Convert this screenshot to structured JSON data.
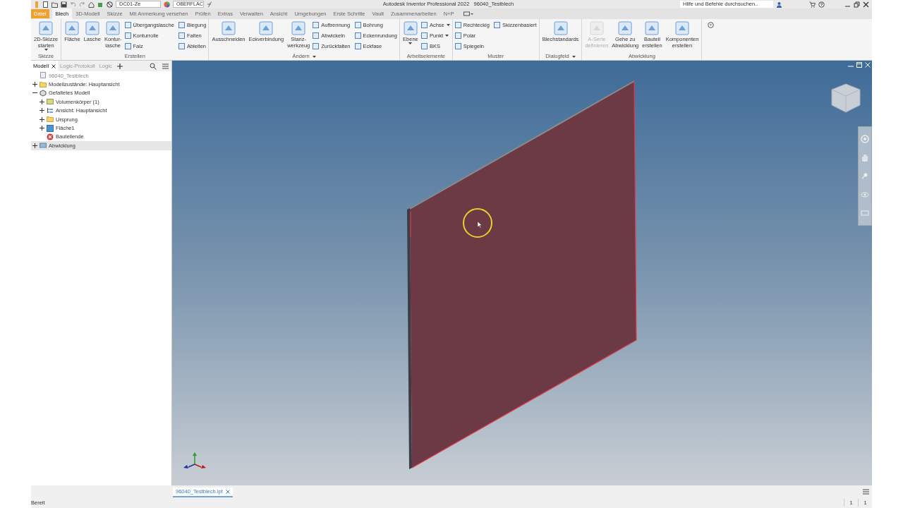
{
  "window": {
    "title": "Autodesk Inventor Professional 2022   96040_Testblech",
    "search": {
      "placeholder": "Hilfe und Befehle durchsuchen.."
    }
  },
  "quick_access": {
    "design_view": "DC01-Ze",
    "appearance": "OBERFLAC"
  },
  "menu_tabs": [
    {
      "label": "Datei",
      "kind": "file",
      "selected": false
    },
    {
      "label": "Blech",
      "kind": "tab",
      "selected": true
    },
    {
      "label": "3D-Modell",
      "kind": "tab",
      "selected": false
    },
    {
      "label": "Skizze",
      "kind": "tab",
      "selected": false
    },
    {
      "label": "Mit Anmerkung versehen",
      "kind": "tab",
      "selected": false
    },
    {
      "label": "Prüfen",
      "kind": "tab",
      "selected": false
    },
    {
      "label": "Extras",
      "kind": "tab",
      "selected": false
    },
    {
      "label": "Verwalten",
      "kind": "tab",
      "selected": false
    },
    {
      "label": "Ansicht",
      "kind": "tab",
      "selected": false
    },
    {
      "label": "Umgebungen",
      "kind": "tab",
      "selected": false
    },
    {
      "label": "Erste Schritte",
      "kind": "tab",
      "selected": false
    },
    {
      "label": "Vault",
      "kind": "tab",
      "selected": false
    },
    {
      "label": "Zusammenarbeiten",
      "kind": "tab",
      "selected": false
    },
    {
      "label": "N+P",
      "kind": "tab",
      "selected": false
    }
  ],
  "ribbon": [
    {
      "title": "Skizze",
      "menu": false,
      "tools": [
        {
          "lines": [
            "2D-Skizze",
            "starten"
          ],
          "kind": "large",
          "disabled": false,
          "menu": true
        }
      ]
    },
    {
      "title": "Erstellen",
      "menu": false,
      "tools": [
        {
          "lines": [
            "Fläche"
          ],
          "kind": "large",
          "disabled": false,
          "menu": false
        },
        {
          "lines": [
            "Lasche"
          ],
          "kind": "large",
          "disabled": false,
          "menu": false
        },
        {
          "lines": [
            "Kontur-",
            "lasche"
          ],
          "kind": "large",
          "disabled": false,
          "menu": false
        },
        {
          "lines": [
            "Übergangslasche"
          ],
          "kind": "small",
          "disabled": false,
          "menu": false
        },
        {
          "lines": [
            "Konturrolle"
          ],
          "kind": "small",
          "disabled": false,
          "menu": false
        },
        {
          "lines": [
            "Falz"
          ],
          "kind": "small",
          "disabled": false,
          "menu": false
        },
        {
          "lines": [
            "Biegung"
          ],
          "kind": "small",
          "disabled": false,
          "menu": false
        },
        {
          "lines": [
            "Falten"
          ],
          "kind": "small",
          "disabled": false,
          "menu": false
        },
        {
          "lines": [
            "Ableiten"
          ],
          "kind": "small",
          "disabled": false,
          "menu": false
        }
      ]
    },
    {
      "title": "Ändern",
      "menu": true,
      "tools": [
        {
          "lines": [
            "Ausschneiden"
          ],
          "kind": "large",
          "disabled": false,
          "menu": false
        },
        {
          "lines": [
            "Eckverbindung"
          ],
          "kind": "large",
          "disabled": false,
          "menu": false
        },
        {
          "lines": [
            "Stanz-",
            "werkzeug"
          ],
          "kind": "large",
          "disabled": false,
          "menu": false
        },
        {
          "lines": [
            "Auftrennung"
          ],
          "kind": "small",
          "disabled": false,
          "menu": false
        },
        {
          "lines": [
            "Abwickeln"
          ],
          "kind": "small",
          "disabled": false,
          "menu": false
        },
        {
          "lines": [
            "Zurückfalten"
          ],
          "kind": "small",
          "disabled": false,
          "menu": false
        },
        {
          "lines": [
            "Bohrung"
          ],
          "kind": "small",
          "disabled": false,
          "menu": false
        },
        {
          "lines": [
            "Eckenrundung"
          ],
          "kind": "small",
          "disabled": false,
          "menu": false
        },
        {
          "lines": [
            "Eckfase"
          ],
          "kind": "small",
          "disabled": false,
          "menu": false
        }
      ]
    },
    {
      "title": "Arbeitselemente",
      "menu": false,
      "tools": [
        {
          "lines": [
            "Ebene"
          ],
          "kind": "large",
          "disabled": false,
          "menu": true
        },
        {
          "lines": [
            "Achse"
          ],
          "kind": "small",
          "disabled": false,
          "menu": true
        },
        {
          "lines": [
            "Punkt"
          ],
          "kind": "small",
          "disabled": false,
          "menu": true
        },
        {
          "lines": [
            "BKS"
          ],
          "kind": "small",
          "disabled": false,
          "menu": false
        }
      ]
    },
    {
      "title": "Muster",
      "menu": false,
      "tools": [
        {
          "lines": [
            "Rechteckig"
          ],
          "kind": "small",
          "disabled": false,
          "menu": false
        },
        {
          "lines": [
            "Polar"
          ],
          "kind": "small",
          "disabled": false,
          "menu": false
        },
        {
          "lines": [
            "Spiegeln"
          ],
          "kind": "small",
          "disabled": false,
          "menu": false
        },
        {
          "lines": [
            "Skizzenbasiert"
          ],
          "kind": "small",
          "disabled": false,
          "menu": false
        }
      ]
    },
    {
      "title": "Dialogfeld",
      "menu": true,
      "tools": [
        {
          "lines": [
            "Blechstandards"
          ],
          "kind": "large",
          "disabled": false,
          "menu": false
        }
      ]
    },
    {
      "title": "Abwicklung",
      "menu": false,
      "tools": [
        {
          "lines": [
            "A-Serie",
            "definieren"
          ],
          "kind": "large",
          "disabled": true,
          "menu": false
        },
        {
          "lines": [
            "Gehe zu",
            "Abwicklung"
          ],
          "kind": "large",
          "disabled": false,
          "menu": false
        },
        {
          "lines": [
            "Bauteil",
            "erstellen"
          ],
          "kind": "large",
          "disabled": false,
          "menu": false
        },
        {
          "lines": [
            "Komponenten",
            "erstellen"
          ],
          "kind": "large",
          "disabled": false,
          "menu": false
        }
      ]
    }
  ],
  "browser": {
    "tabs": [
      {
        "label": "Modell",
        "selected": true,
        "closable": true
      },
      {
        "label": "Logic-Protokoll",
        "selected": false,
        "closable": false
      },
      {
        "label": "Logic",
        "selected": false,
        "closable": false
      }
    ],
    "tree": [
      {
        "label": "96040_Testblech",
        "kind": "part",
        "selected": false,
        "children": [
          {
            "label": "Modellzustände: Hauptansicht",
            "kind": "folder",
            "expanded": false,
            "selected": false
          },
          {
            "label": "Gefaltetes Modell",
            "kind": "model",
            "expanded": true,
            "selected": false,
            "children": [
              {
                "label": "Volumenkörper (1)",
                "kind": "body",
                "expanded": false,
                "selected": false
              },
              {
                "label": "Ansicht: Hauptansicht",
                "kind": "view",
                "expanded": false,
                "selected": false
              },
              {
                "label": "Ursprung",
                "kind": "folder",
                "expanded": false,
                "selected": false
              },
              {
                "label": "Fläche1",
                "kind": "face",
                "expanded": false,
                "selected": false
              },
              {
                "label": "Bauteilende",
                "kind": "end",
                "selected": false
              }
            ]
          },
          {
            "label": "Abwicklung",
            "kind": "flat",
            "expanded": false,
            "selected": true
          }
        ]
      }
    ]
  },
  "document_tabs": [
    {
      "label": "96040_Testblech.ipt",
      "selected": true
    }
  ],
  "status_bar": {
    "message": "Bereit",
    "counters": [
      "1",
      "1"
    ]
  }
}
